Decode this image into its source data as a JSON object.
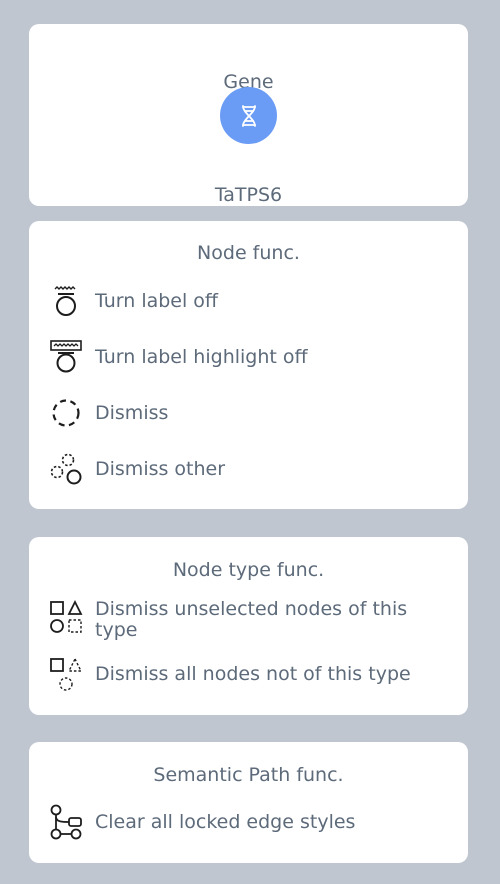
{
  "gene_card": {
    "title": "Gene",
    "name": "TaTPS6",
    "icon": "dna-icon",
    "accent": "#6b9cf5"
  },
  "node_card": {
    "title": "Node func.",
    "items": [
      {
        "label": "Turn label off",
        "icon": "label-off-icon"
      },
      {
        "label": "Turn label highlight off",
        "icon": "label-highlight-off-icon"
      },
      {
        "label": "Dismiss",
        "icon": "dismiss-node-icon"
      },
      {
        "label": "Dismiss other",
        "icon": "dismiss-other-icon"
      }
    ]
  },
  "node_type_card": {
    "title": "Node type func.",
    "items": [
      {
        "label": "Dismiss unselected nodes of this type",
        "icon": "dismiss-unselected-type-icon"
      },
      {
        "label": "Dismiss all nodes not of this type",
        "icon": "dismiss-not-type-icon"
      }
    ]
  },
  "semantic_path_card": {
    "title": "Semantic Path func.",
    "items": [
      {
        "label": "Clear all locked edge styles",
        "icon": "clear-edge-styles-icon"
      }
    ]
  }
}
